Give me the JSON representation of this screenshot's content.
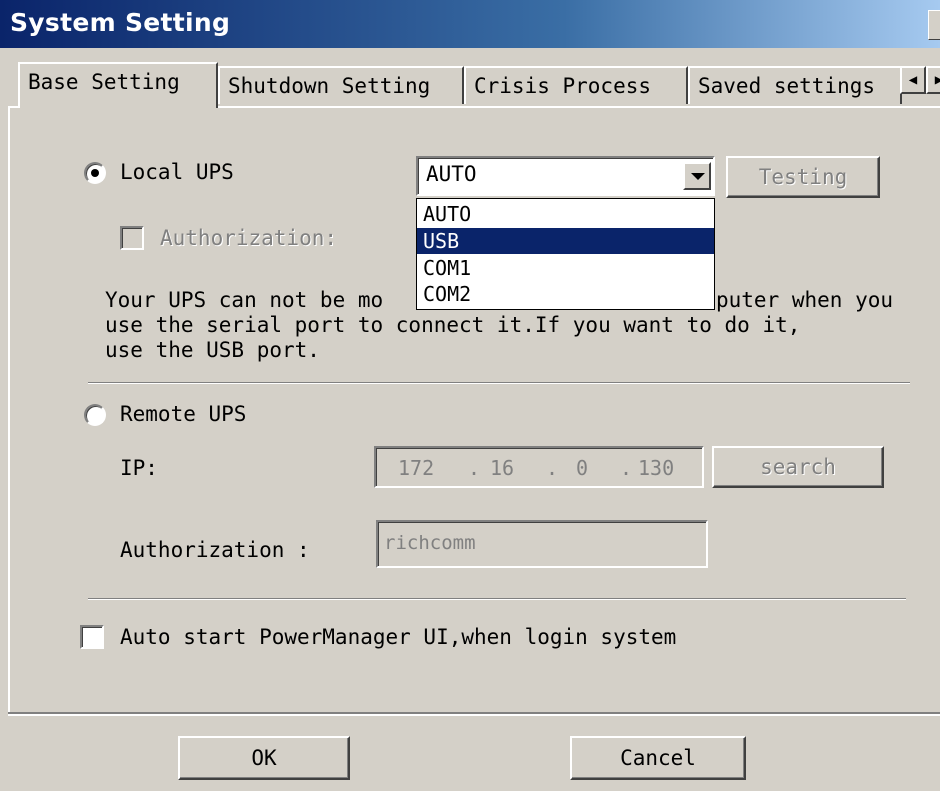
{
  "window": {
    "title": "System Setting"
  },
  "tabs": [
    {
      "label": "Base Setting"
    },
    {
      "label": "Shutdown Setting"
    },
    {
      "label": "Crisis Process"
    },
    {
      "label": "Saved settings"
    }
  ],
  "local_ups": {
    "label": "Local UPS",
    "selected": true,
    "port_combo": {
      "value": "AUTO"
    },
    "testing_button": "Testing",
    "authorization_label": "Authorization:",
    "authorization_checked": false,
    "port_options": [
      {
        "label": "AUTO",
        "selected": false
      },
      {
        "label": "USB",
        "selected": true
      },
      {
        "label": "COM1",
        "selected": false
      },
      {
        "label": "COM2",
        "selected": false
      }
    ],
    "note_line1_a": "Your UPS can not be mo",
    "note_line1_b": "puter when you",
    "note_line2": "use the serial port to connect it.If you want to do it,",
    "note_line3": "use the USB port."
  },
  "remote_ups": {
    "label": "Remote UPS",
    "selected": false,
    "ip_label": "IP:",
    "ip_octets": [
      "172",
      "16",
      "0",
      "130"
    ],
    "search_button": "search",
    "authorization_label": "Authorization :",
    "authorization_value": "richcomm"
  },
  "autostart": {
    "label": "Auto start PowerManager UI,when login system",
    "checked": false
  },
  "footer": {
    "ok_button": "OK",
    "cancel_button": "Cancel"
  },
  "colors": {
    "titlebar_start": "#0a246a",
    "face": "#d4d0c8",
    "selection": "#0a246a"
  }
}
